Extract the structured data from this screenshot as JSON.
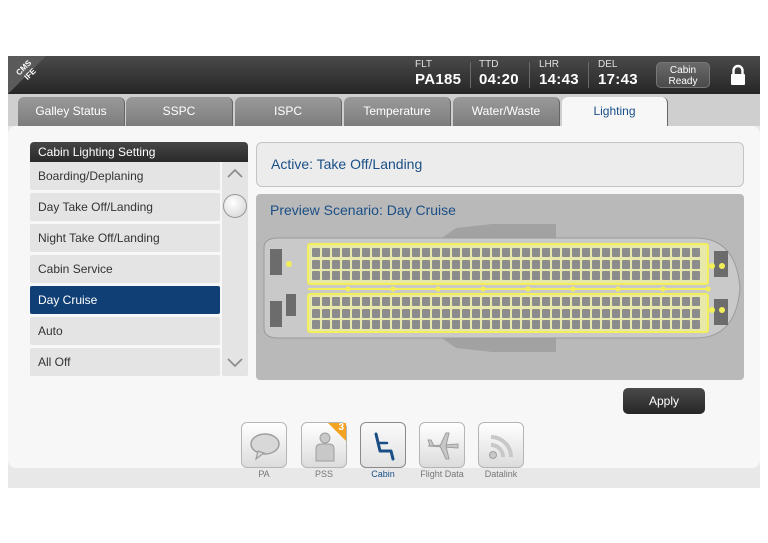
{
  "header": {
    "logo_line1": "CMS",
    "logo_line2": "IFE",
    "flt_label": "FLT",
    "flt_value": "PA185",
    "ttd_label": "TTD",
    "ttd_value": "04:20",
    "origin_label": "LHR",
    "origin_time": "14:43",
    "dest_label": "DEL",
    "dest_time": "17:43",
    "cabin_ready_line1": "Cabin",
    "cabin_ready_line2": "Ready"
  },
  "tabs": [
    {
      "label": "Galley Status"
    },
    {
      "label": "SSPC"
    },
    {
      "label": "ISPC"
    },
    {
      "label": "Temperature"
    },
    {
      "label": "Water/Waste"
    },
    {
      "label": "Lighting"
    }
  ],
  "active_tab": "Lighting",
  "lighting_list": {
    "title": "Cabin Lighting Setting",
    "items": [
      {
        "label": "Boarding/Deplaning"
      },
      {
        "label": "Day Take Off/Landing"
      },
      {
        "label": "Night Take Off/Landing"
      },
      {
        "label": "Cabin Service"
      },
      {
        "label": "Day Cruise"
      },
      {
        "label": "Auto"
      },
      {
        "label": "All Off"
      }
    ],
    "selected": "Day Cruise"
  },
  "active_status": "Active: Take Off/Landing",
  "preview_title": "Preview Scenario: Day Cruise",
  "apply_label": "Apply",
  "bottom_nav": [
    {
      "label": "PA",
      "icon": "speech-bubble-icon"
    },
    {
      "label": "PSS",
      "icon": "passenger-icon",
      "badge": "3"
    },
    {
      "label": "Cabin",
      "icon": "seat-icon"
    },
    {
      "label": "Flight Data",
      "icon": "airplane-icon"
    },
    {
      "label": "Datalink",
      "icon": "signal-icon"
    }
  ],
  "active_nav": "Cabin",
  "colors": {
    "accent_blue": "#1a4f86",
    "selected_item": "#0f3f74",
    "light_yellow": "#f2ef5a",
    "badge_orange": "#f3a321"
  }
}
